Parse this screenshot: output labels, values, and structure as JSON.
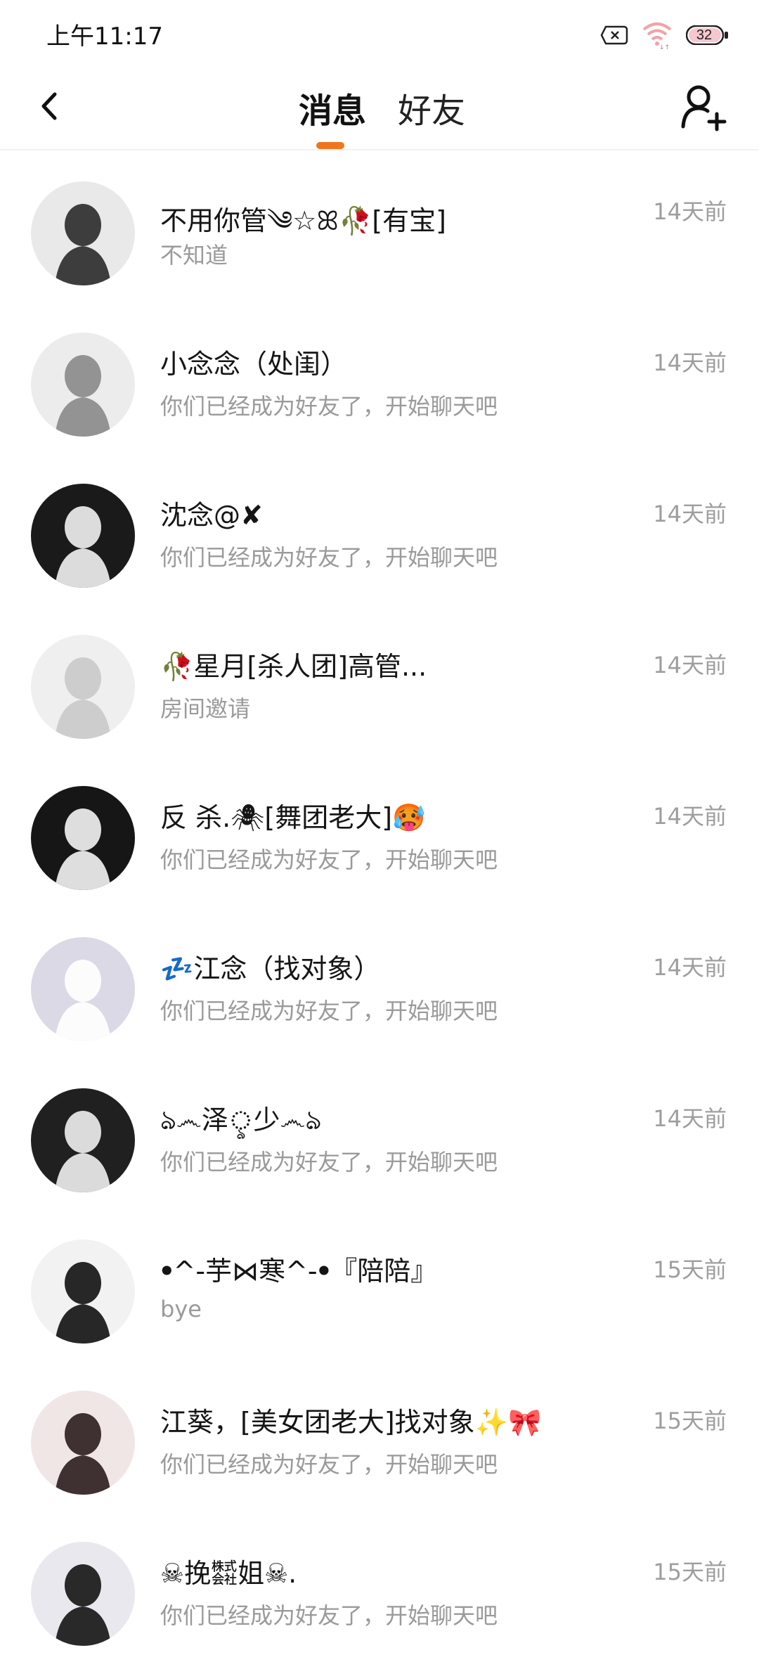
{
  "status": {
    "time": "上午11:17",
    "battery": "32"
  },
  "header": {
    "tabs": [
      {
        "label": "消息",
        "active": true
      },
      {
        "label": "好友",
        "active": false
      }
    ],
    "accent_color": "#f0761d"
  },
  "conversations": [
    {
      "name": "不用你管༄☆ꕤ🥀[有宝]",
      "preview": "不知道",
      "time": "14天前",
      "avatar_bg": "#e9e9e9",
      "avatar_fg": "#2a2a2a"
    },
    {
      "name": "小念念（处闺）",
      "preview": "你们已经成为好友了，开始聊天吧",
      "time": "14天前",
      "avatar_bg": "#ececec",
      "avatar_fg": "#8a8a8a"
    },
    {
      "name": "沈念@✘",
      "preview": "你们已经成为好友了，开始聊天吧",
      "time": "14天前",
      "avatar_bg": "#1a1a1a",
      "avatar_fg": "#f2f2f2"
    },
    {
      "name": "🥀星月[杀人团]高管...",
      "preview": "房间邀请",
      "time": "14天前",
      "avatar_bg": "#efefef",
      "avatar_fg": "#c9c9c9"
    },
    {
      "name": "反 杀.🕷[舞团老大]🥵",
      "preview": "你们已经成为好友了，开始聊天吧",
      "time": "14天前",
      "avatar_bg": "#161616",
      "avatar_fg": "#f4f4f4"
    },
    {
      "name": "💤江念（找对象）",
      "preview": "你们已经成为好友了，开始聊天吧",
      "time": "14天前",
      "avatar_bg": "#dcd9e6",
      "avatar_fg": "#ffffff"
    },
    {
      "name": "ঌ෴泽ৢ少෴ঌ",
      "preview": "你们已经成为好友了，开始聊天吧",
      "time": "14天前",
      "avatar_bg": "#202020",
      "avatar_fg": "#f0f0f0"
    },
    {
      "name": "ꔷ^-芋⋈寒^-ꔷ『陪陪』",
      "preview": "bye",
      "time": "15天前",
      "avatar_bg": "#f2f2f2",
      "avatar_fg": "#111111"
    },
    {
      "name": "江葵，[美女团老大]找对象✨🎀",
      "preview": "你们已经成为好友了，开始聊天吧",
      "time": "15天前",
      "avatar_bg": "#f1e6e6",
      "avatar_fg": "#2b1d1d"
    },
    {
      "name": "☠挽㍿姐☠.",
      "preview": "你们已经成为好友了，开始聊天吧",
      "time": "15天前",
      "avatar_bg": "#e8e8ee",
      "avatar_fg": "#141414"
    }
  ]
}
